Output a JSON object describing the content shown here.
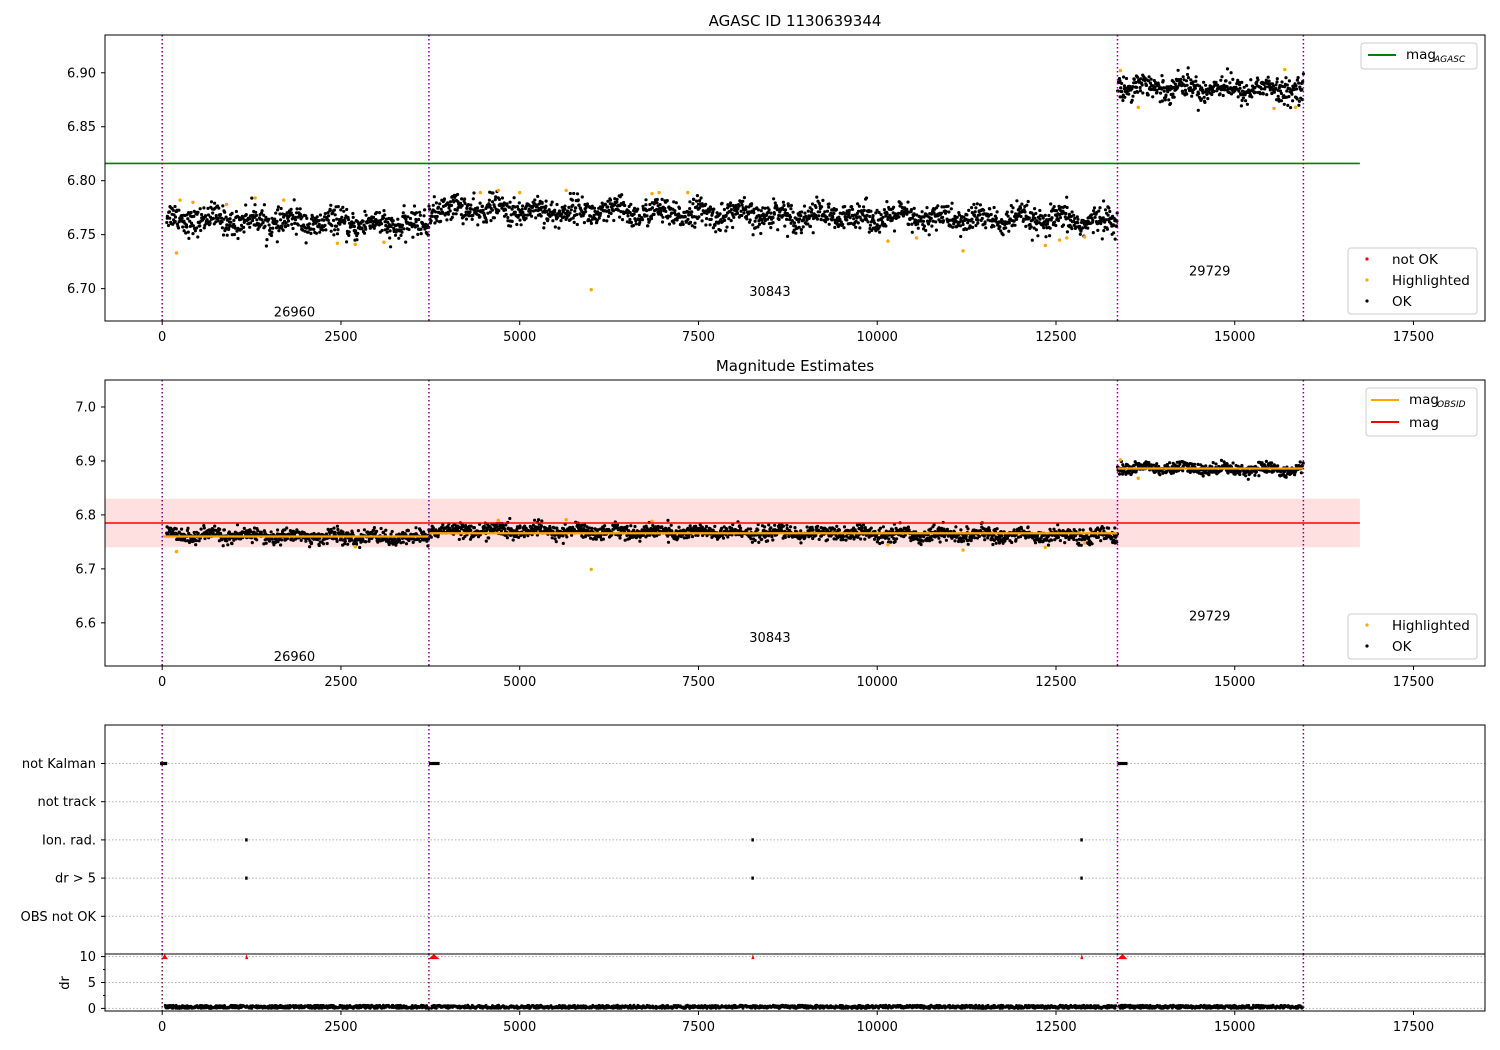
{
  "chart_data": [
    {
      "type": "scatter",
      "title": "AGASC ID 1130639344",
      "xlim": [
        -800,
        18500
      ],
      "ylim": [
        6.67,
        6.935
      ],
      "x_ticks": [
        0,
        2500,
        5000,
        7500,
        10000,
        12500,
        15000,
        17500
      ],
      "y_ticks": [
        6.7,
        6.75,
        6.8,
        6.85,
        6.9
      ],
      "y_tick_labels": [
        "6.70",
        "6.75",
        "6.80",
        "6.85",
        "6.90"
      ],
      "obsid_boundaries": [
        0,
        3730,
        13360,
        15960
      ],
      "obsid_labels": [
        {
          "text": "26960",
          "x": 1850,
          "y": 6.678
        },
        {
          "text": "30843",
          "x": 8500,
          "y": 6.697
        },
        {
          "text": "29729",
          "x": 14650,
          "y": 6.716
        }
      ],
      "mag_agasc": 6.816,
      "mag_agasc_color": "#008000",
      "segments": [
        {
          "x_start": 60,
          "x_end": 3730,
          "y_start": 6.765,
          "y_end": 6.758,
          "spread": 0.011
        },
        {
          "x_start": 3730,
          "x_end": 13360,
          "y_start": 6.774,
          "y_end": 6.762,
          "spread": 0.011
        },
        {
          "x_start": 13360,
          "x_end": 15960,
          "y_start": 6.888,
          "y_end": 6.884,
          "spread": 0.01
        }
      ],
      "highlighted_points": [
        {
          "x": 200,
          "y": 6.733
        },
        {
          "x": 250,
          "y": 6.782
        },
        {
          "x": 430,
          "y": 6.78
        },
        {
          "x": 900,
          "y": 6.778
        },
        {
          "x": 1300,
          "y": 6.784
        },
        {
          "x": 1700,
          "y": 6.782
        },
        {
          "x": 2450,
          "y": 6.742
        },
        {
          "x": 2700,
          "y": 6.741
        },
        {
          "x": 3100,
          "y": 6.743
        },
        {
          "x": 4450,
          "y": 6.789
        },
        {
          "x": 4700,
          "y": 6.791
        },
        {
          "x": 5000,
          "y": 6.789
        },
        {
          "x": 5650,
          "y": 6.791
        },
        {
          "x": 6000,
          "y": 6.699
        },
        {
          "x": 6850,
          "y": 6.788
        },
        {
          "x": 6950,
          "y": 6.789
        },
        {
          "x": 7350,
          "y": 6.789
        },
        {
          "x": 10150,
          "y": 6.744
        },
        {
          "x": 10550,
          "y": 6.747
        },
        {
          "x": 11200,
          "y": 6.735
        },
        {
          "x": 12350,
          "y": 6.74
        },
        {
          "x": 12550,
          "y": 6.745
        },
        {
          "x": 12650,
          "y": 6.747
        },
        {
          "x": 12900,
          "y": 6.748
        },
        {
          "x": 13400,
          "y": 6.902
        },
        {
          "x": 13650,
          "y": 6.868
        },
        {
          "x": 15550,
          "y": 6.867
        },
        {
          "x": 15700,
          "y": 6.903
        },
        {
          "x": 15850,
          "y": 6.868
        }
      ],
      "legend_upper": [
        {
          "label": "mag",
          "subscript": "AGASC",
          "color": "#008000"
        }
      ],
      "legend_lower": [
        {
          "label": "not OK",
          "color": "#ff0000"
        },
        {
          "label": "Highlighted",
          "color": "#ffa500"
        },
        {
          "label": "OK",
          "color": "#000000"
        }
      ]
    },
    {
      "type": "scatter",
      "title": "Magnitude Estimates",
      "xlim": [
        -800,
        18500
      ],
      "ylim": [
        6.52,
        7.05
      ],
      "x_ticks": [
        0,
        2500,
        5000,
        7500,
        10000,
        12500,
        15000,
        17500
      ],
      "y_ticks": [
        6.6,
        6.7,
        6.8,
        6.9,
        7.0
      ],
      "y_tick_labels": [
        "6.6",
        "6.7",
        "6.8",
        "6.9",
        "7.0"
      ],
      "obsid_boundaries": [
        0,
        3730,
        13360,
        15960
      ],
      "obsid_labels": [
        {
          "text": "26960",
          "x": 1850,
          "y": 6.537
        },
        {
          "text": "30843",
          "x": 8500,
          "y": 6.572
        },
        {
          "text": "29729",
          "x": 14650,
          "y": 6.612
        }
      ],
      "mag": 6.785,
      "mag_band": [
        6.74,
        6.83
      ],
      "mag_color": "#ff0000",
      "mag_obsid": [
        {
          "x_start": 0,
          "x_end": 3730,
          "value": 6.76
        },
        {
          "x_start": 3730,
          "x_end": 13360,
          "value": 6.766
        },
        {
          "x_start": 13360,
          "x_end": 15960,
          "value": 6.886
        }
      ],
      "mag_obsid_color": "#ffa500",
      "segments": [
        {
          "x_start": 60,
          "x_end": 3730,
          "y_start": 6.763,
          "y_end": 6.757,
          "spread": 0.012
        },
        {
          "x_start": 3730,
          "x_end": 13360,
          "y_start": 6.772,
          "y_end": 6.761,
          "spread": 0.012
        },
        {
          "x_start": 13360,
          "x_end": 15960,
          "y_start": 6.887,
          "y_end": 6.884,
          "spread": 0.01
        }
      ],
      "highlighted_points": [
        {
          "x": 200,
          "y": 6.732
        },
        {
          "x": 2700,
          "y": 6.741
        },
        {
          "x": 4700,
          "y": 6.79
        },
        {
          "x": 5650,
          "y": 6.791
        },
        {
          "x": 6000,
          "y": 6.699
        },
        {
          "x": 6850,
          "y": 6.788
        },
        {
          "x": 10150,
          "y": 6.745
        },
        {
          "x": 11200,
          "y": 6.735
        },
        {
          "x": 12350,
          "y": 6.74
        },
        {
          "x": 12900,
          "y": 6.748
        },
        {
          "x": 13400,
          "y": 6.902
        },
        {
          "x": 13650,
          "y": 6.868
        }
      ],
      "legend_upper": [
        {
          "label": "mag",
          "subscript": "OBSID",
          "color": "#ffa500"
        },
        {
          "label": "mag",
          "subscript": "",
          "color": "#ff0000"
        }
      ],
      "legend_lower": [
        {
          "label": "Highlighted",
          "color": "#ffa500"
        },
        {
          "label": "OK",
          "color": "#000000"
        }
      ]
    },
    {
      "type": "scatter",
      "title": "",
      "xlim": [
        -800,
        18500
      ],
      "x_ticks": [
        0,
        2500,
        5000,
        7500,
        10000,
        12500,
        15000,
        17500
      ],
      "flag_rows": [
        "not Kalman",
        "not track",
        "Ion. rad.",
        "dr > 5",
        "OBS not OK"
      ],
      "obsid_boundaries": [
        0,
        3730,
        13360,
        15960
      ],
      "flag_points": [
        {
          "row": "not Kalman",
          "x_start": -30,
          "x_end": 70
        },
        {
          "row": "not Kalman",
          "x_start": 3730,
          "x_end": 3880
        },
        {
          "row": "not Kalman",
          "x_start": 13360,
          "x_end": 13500
        },
        {
          "row": "Ion. rad.",
          "x_start": 1160,
          "x_end": 1170
        },
        {
          "row": "Ion. rad.",
          "x_start": 8240,
          "x_end": 8250
        },
        {
          "row": "Ion. rad.",
          "x_start": 12840,
          "x_end": 12850
        },
        {
          "row": "dr > 5",
          "x_start": 1160,
          "x_end": 1170
        },
        {
          "row": "dr > 5",
          "x_start": 8240,
          "x_end": 8250
        },
        {
          "row": "dr > 5",
          "x_start": 12840,
          "x_end": 12850
        }
      ]
    },
    {
      "type": "scatter",
      "title": "",
      "ylabel": "dr",
      "xlim": [
        -800,
        18500
      ],
      "ylim": [
        -0.5,
        10.5
      ],
      "y_ticks": [
        0,
        5,
        10
      ],
      "y_tick_labels": [
        "0",
        "5",
        "10"
      ],
      "x_ticks": [
        0,
        2500,
        5000,
        7500,
        10000,
        12500,
        15000,
        17500
      ],
      "x_tick_labels": [
        "0",
        "2500",
        "5000",
        "7500",
        "10000",
        "12500",
        "15000",
        "17500"
      ],
      "obsid_boundaries": [
        0,
        3730,
        13360,
        15960
      ],
      "ok_dr_range": [
        0.0,
        0.6
      ],
      "ok_segments": [
        {
          "x_start": 40,
          "x_end": 3730
        },
        {
          "x_start": 3760,
          "x_end": 13340
        },
        {
          "x_start": 13380,
          "x_end": 15960
        }
      ],
      "clipped_points": [
        {
          "x_start": -10,
          "x_end": 80,
          "dr": 10
        },
        {
          "x_start": 1160,
          "x_end": 1170,
          "dr": 10
        },
        {
          "x_start": 3720,
          "x_end": 3880,
          "dr": 10
        },
        {
          "x_start": 8240,
          "x_end": 8250,
          "dr": 10
        },
        {
          "x_start": 12840,
          "x_end": 12850,
          "dr": 10
        },
        {
          "x_start": 13360,
          "x_end": 13500,
          "dr": 10
        }
      ],
      "clipped_color": "#ff0000"
    }
  ]
}
